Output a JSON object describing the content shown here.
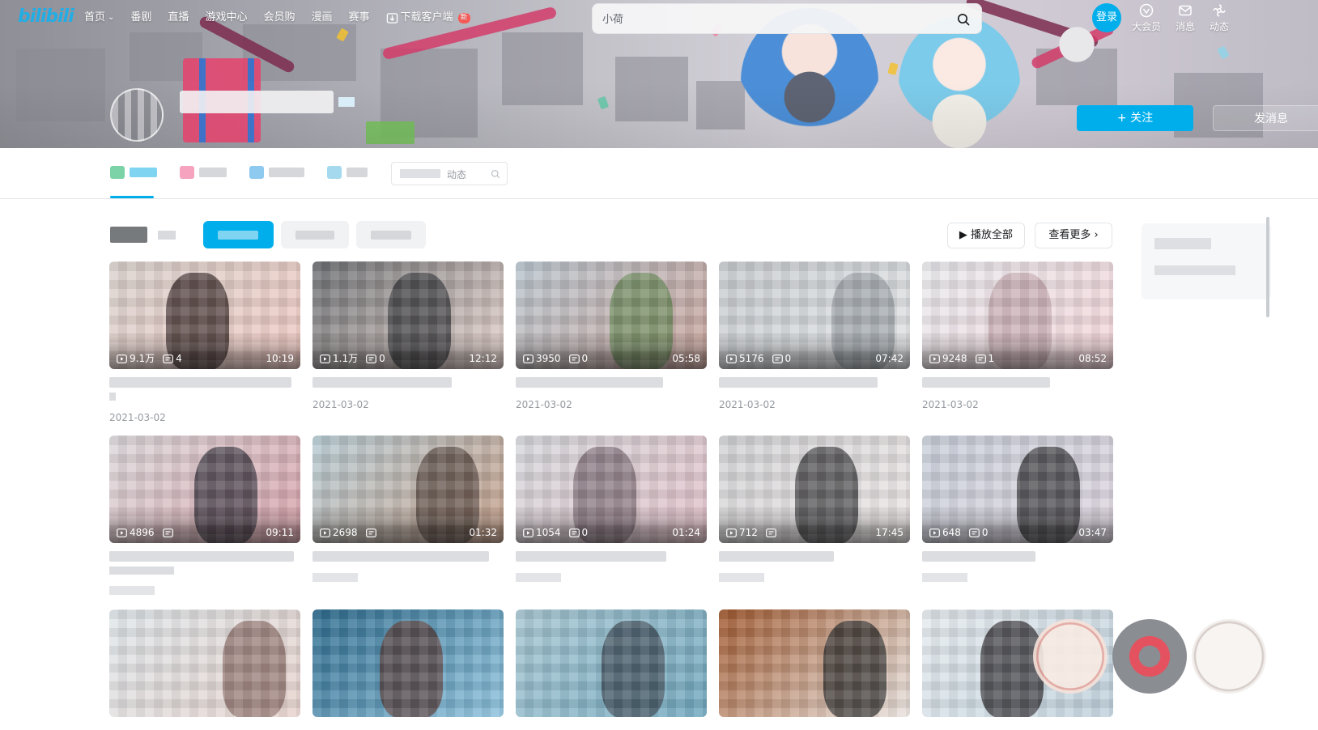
{
  "nav": {
    "logo": "bilibili",
    "items": [
      {
        "label": "首页",
        "has_dropdown": true
      },
      {
        "label": "番剧"
      },
      {
        "label": "直播"
      },
      {
        "label": "游戏中心"
      },
      {
        "label": "会员购"
      },
      {
        "label": "漫画"
      },
      {
        "label": "赛事"
      }
    ],
    "download": {
      "label": "下载客户端",
      "badge": "新"
    },
    "search": {
      "placeholder": "小荷"
    },
    "login_label": "登录",
    "right": [
      {
        "label": "大会员",
        "icon": "vip-icon"
      },
      {
        "label": "消息",
        "icon": "message-icon"
      },
      {
        "label": "动态",
        "icon": "dynamic-icon"
      }
    ]
  },
  "profile": {
    "follow_label": "+ 关注",
    "message_label": "发消息"
  },
  "tabs": {
    "search_placeholder": "动态",
    "active_index": 0
  },
  "section": {
    "play_all_label": "▶ 播放全部",
    "more_label": "查看更多 ›"
  },
  "videos": [
    {
      "views": "9.1万",
      "danmaku": "4",
      "duration": "10:19",
      "date": "2021-03-02"
    },
    {
      "views": "1.1万",
      "danmaku": "0",
      "duration": "12:12",
      "date": "2021-03-02"
    },
    {
      "views": "3950",
      "danmaku": "0",
      "duration": "05:58",
      "date": "2021-03-02"
    },
    {
      "views": "5176",
      "danmaku": "0",
      "duration": "07:42",
      "date": "2021-03-02"
    },
    {
      "views": "9248",
      "danmaku": "1",
      "duration": "08:52",
      "date": "2021-03-02"
    },
    {
      "views": "4896",
      "danmaku": "",
      "duration": "09:11",
      "date": ""
    },
    {
      "views": "2698",
      "danmaku": "",
      "duration": "01:32",
      "date": ""
    },
    {
      "views": "1054",
      "danmaku": "0",
      "duration": "01:24",
      "date": ""
    },
    {
      "views": "712",
      "danmaku": "",
      "duration": "17:45",
      "date": ""
    },
    {
      "views": "648",
      "danmaku": "0",
      "duration": "03:47",
      "date": ""
    },
    {
      "views": "",
      "danmaku": "",
      "duration": "",
      "date": ""
    },
    {
      "views": "",
      "danmaku": "",
      "duration": "",
      "date": ""
    },
    {
      "views": "",
      "danmaku": "",
      "duration": "",
      "date": ""
    },
    {
      "views": "",
      "danmaku": "",
      "duration": "",
      "date": ""
    },
    {
      "views": "",
      "danmaku": "",
      "duration": "",
      "date": ""
    }
  ],
  "colors": {
    "brand": "#00aeec",
    "logo": "#23ade5",
    "badge": "#fa5a57"
  }
}
